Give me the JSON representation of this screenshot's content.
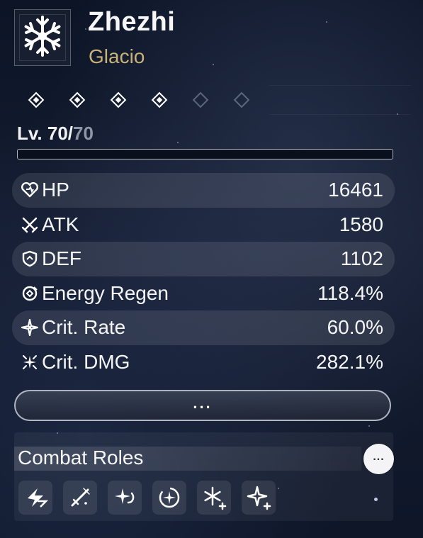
{
  "character": {
    "name": "Zhezhi",
    "element": "Glacio",
    "emblem_icon": "snowflake-icon"
  },
  "sequence": {
    "total": 6,
    "unlocked": 4
  },
  "level": {
    "prefix": "Lv. ",
    "current": "70",
    "separator": "/",
    "max": "70"
  },
  "stats": [
    {
      "label": "HP",
      "value": "16461",
      "icon": "heart-icon"
    },
    {
      "label": "ATK",
      "value": "1580",
      "icon": "swords-icon"
    },
    {
      "label": "DEF",
      "value": "1102",
      "icon": "shield-icon"
    },
    {
      "label": "Energy Regen",
      "value": "118.4%",
      "icon": "energy-regen-icon"
    },
    {
      "label": "Crit. Rate",
      "value": "60.0%",
      "icon": "crit-rate-icon"
    },
    {
      "label": "Crit. DMG",
      "value": "282.1%",
      "icon": "crit-dmg-icon"
    }
  ],
  "more_button": {
    "label": "..."
  },
  "combat_roles": {
    "title": "Combat Roles",
    "more_label": "...",
    "roles": [
      "bolt-role-icon",
      "sword-role-icon",
      "sparkle-swirl-role-icon",
      "star-circle-role-icon",
      "snowflake-plus-role-icon",
      "sparkle-plus-role-icon"
    ]
  },
  "colors": {
    "element_gold": "#c9b27a",
    "level_max_gray": "#8f97a6"
  }
}
